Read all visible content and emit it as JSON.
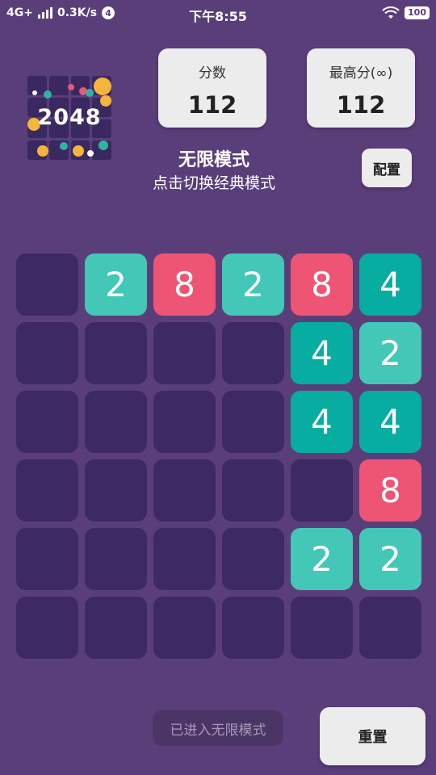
{
  "status_bar": {
    "network": "4G+",
    "speed": "0.3K/s",
    "notification_count": "4",
    "time": "下午8:55",
    "battery": "100"
  },
  "logo": {
    "text": "2048"
  },
  "score": {
    "label": "分数",
    "value": "112"
  },
  "best": {
    "label": "最高分(∞)",
    "value": "112"
  },
  "mode": {
    "title": "无限模式",
    "subtitle": "点击切换经典模式"
  },
  "config_label": "配置",
  "toast_text": "已进入无限模式",
  "reset_label": "重置",
  "colors": {
    "background": "#5a3e7a",
    "empty_cell": "#3d2a63",
    "tile_2": "#43c7b6",
    "tile_4": "#07ada0",
    "tile_8": "#ee5574"
  },
  "board": [
    [
      "",
      "2",
      "8",
      "2",
      "8",
      "4"
    ],
    [
      "",
      "",
      "",
      "",
      "4",
      "2"
    ],
    [
      "",
      "",
      "",
      "",
      "4",
      "4"
    ],
    [
      "",
      "",
      "",
      "",
      "",
      "8"
    ],
    [
      "",
      "",
      "",
      "",
      "2",
      "2"
    ],
    [
      "",
      "",
      "",
      "",
      "",
      ""
    ]
  ]
}
